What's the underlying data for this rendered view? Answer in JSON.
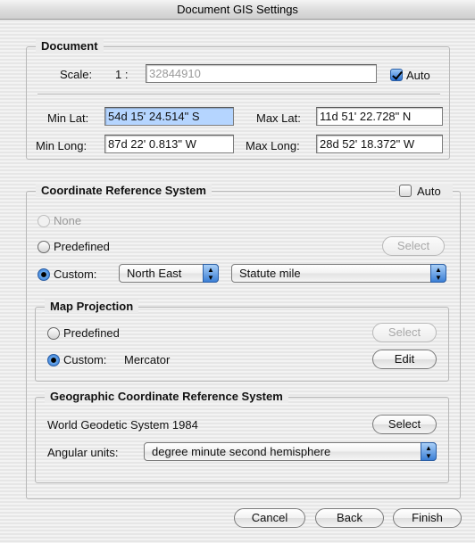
{
  "window": {
    "title": "Document GIS Settings"
  },
  "document": {
    "legend": "Document",
    "scale_label": "Scale:",
    "scale_prefix": "1 :",
    "scale_value": "32844910",
    "auto_label": "Auto",
    "auto_checked": true,
    "min_lat_label": "Min Lat:",
    "min_lat_value": "54d 15' 24.514\" S",
    "max_lat_label": "Max Lat:",
    "max_lat_value": "11d 51' 22.728\" N",
    "min_long_label": "Min Long:",
    "min_long_value": "87d 22' 0.813\" W",
    "max_long_label": "Max Long:",
    "max_long_value": "28d 52' 18.372\" W"
  },
  "crs": {
    "legend": "Coordinate Reference System",
    "auto_label": "Auto",
    "auto_checked": false,
    "none_label": "None",
    "predefined_label": "Predefined",
    "predefined_select_label": "Select",
    "custom_label": "Custom:",
    "orientation_value": "North East",
    "units_value": "Statute mile"
  },
  "projection": {
    "legend": "Map Projection",
    "predefined_label": "Predefined",
    "select_label": "Select",
    "custom_label": "Custom:",
    "custom_value": "Mercator",
    "edit_label": "Edit"
  },
  "geo_crs": {
    "legend": "Geographic Coordinate Reference System",
    "name": "World Geodetic System 1984",
    "select_label": "Select",
    "angular_label": "Angular units:",
    "angular_value": "degree minute second hemisphere"
  },
  "footer": {
    "cancel_label": "Cancel",
    "back_label": "Back",
    "finish_label": "Finish"
  },
  "colors": {
    "selection": "#b5d5ff",
    "aqua_blue": "#3b7fd6",
    "disabled_text": "#9a9a9a"
  }
}
